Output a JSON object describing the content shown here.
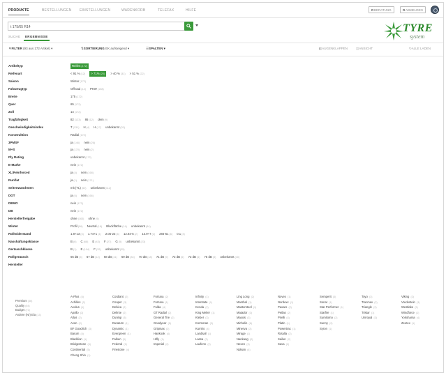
{
  "nav": {
    "items": [
      "PRODUKTE",
      "BESTELLUNGEN",
      "EINSTELLUNGEN",
      "WARENKORB",
      "TELEFAX",
      "HILFE"
    ],
    "buttons": [
      "BERATUNG",
      "ABMELDEN"
    ]
  },
  "search": {
    "value": "t 175/65 R14",
    "clear": "×"
  },
  "logo": {
    "word": "TYRE",
    "sub": "system"
  },
  "subtabs": [
    "SUCHE",
    "ERGEBNISSE"
  ],
  "filterbar": {
    "filter_label": "FILTER",
    "filter_text": "(93 aus 172 Artikel) ▾",
    "sort_label": "SORTIERUNG",
    "sort_text": "EK aufsteigend ▾",
    "columns_label": "SPALTEN ▾",
    "right": [
      "AUGENKLAPPEN",
      "ANSICHT",
      "ALLE LADEN"
    ]
  },
  "rows": [
    {
      "label": "Artikeltyp",
      "values": [
        {
          "t": "Reifen",
          "n": "172",
          "sel": true
        }
      ]
    },
    {
      "label": "Reifenart",
      "values": [
        {
          "t": "< 91 %",
          "n": "12"
        },
        {
          "t": "> 71%",
          "n": "20",
          "sel": true
        },
        {
          "t": "> 40 %",
          "n": "31"
        },
        {
          "t": "> 51 %",
          "n": "22"
        }
      ]
    },
    {
      "label": "Saison",
      "values": [
        {
          "t": "Winter",
          "n": "172"
        }
      ]
    },
    {
      "label": "Fahrzeugtyp",
      "values": [
        {
          "t": "Offroad",
          "n": "14"
        },
        {
          "t": "PKW",
          "n": "158"
        }
      ]
    },
    {
      "label": "Breite",
      "values": [
        {
          "t": "175",
          "n": "172"
        }
      ]
    },
    {
      "label": "Quer",
      "values": [
        {
          "t": "65",
          "n": "172"
        }
      ]
    },
    {
      "label": "Zoll",
      "values": [
        {
          "t": "14",
          "n": "172"
        }
      ]
    },
    {
      "label": "Tragfähigkeit",
      "values": [
        {
          "t": "82",
          "n": "123"
        },
        {
          "t": "86",
          "n": "12"
        },
        {
          "t": "dem",
          "n": "9"
        }
      ]
    },
    {
      "label": "Geschwindigkeitsindex",
      "values": [
        {
          "t": "T",
          "n": "131"
        },
        {
          "t": "H",
          "n": "4"
        },
        {
          "t": "H",
          "n": "17"
        },
        {
          "t": "unbekannt",
          "n": "20"
        }
      ]
    },
    {
      "label": "Konstruktion",
      "values": [
        {
          "t": "Radial",
          "n": "172"
        }
      ]
    },
    {
      "label": "3PMSF",
      "values": [
        {
          "t": "ja",
          "n": "146"
        },
        {
          "t": "nein",
          "n": "26"
        }
      ]
    },
    {
      "label": "M+S",
      "values": [
        {
          "t": "ja",
          "n": "170"
        },
        {
          "t": "nein",
          "n": "2"
        }
      ]
    },
    {
      "label": "Ply Rating",
      "values": [
        {
          "t": "unbekannt",
          "n": "172"
        }
      ]
    },
    {
      "label": "E-Marke",
      "values": [
        {
          "t": "nein",
          "n": "172"
        }
      ]
    },
    {
      "label": "XL/Reinforced",
      "values": [
        {
          "t": "ja",
          "n": "4"
        },
        {
          "t": "nein",
          "n": "168"
        }
      ]
    },
    {
      "label": "Runflat",
      "values": [
        {
          "t": "ja",
          "n": "1"
        },
        {
          "t": "nein",
          "n": "171"
        }
      ]
    },
    {
      "label": "Seitenwandrsten",
      "values": [
        {
          "t": "mit (TL)",
          "n": "60"
        },
        {
          "t": "unbekannt",
          "n": "112"
        }
      ]
    },
    {
      "label": "DOT",
      "values": [
        {
          "t": "ja",
          "n": "6"
        },
        {
          "t": "nein",
          "n": "166"
        }
      ]
    },
    {
      "label": "DEMO",
      "values": [
        {
          "t": "nein",
          "n": "172"
        }
      ]
    },
    {
      "label": "DB",
      "values": [
        {
          "t": "nein",
          "n": "172"
        }
      ]
    },
    {
      "label": "Herstellerfreigabe",
      "values": [
        {
          "t": "ohne",
          "n": "163"
        },
        {
          "t": "ohne",
          "n": "9"
        }
      ]
    },
    {
      "label": "Winter",
      "values": [
        {
          "t": "Profil",
          "n": "56"
        },
        {
          "t": "Neutral",
          "n": "18"
        },
        {
          "t": "Blockfläche",
          "n": "14"
        },
        {
          "t": "unbekannt",
          "n": "84"
        }
      ]
    },
    {
      "label": "Rollwiderstand",
      "values": [
        {
          "t": "1.8+13",
          "n": "3"
        },
        {
          "t": "1.74+1",
          "n": "4"
        },
        {
          "t": "2.06-23",
          "n": "6"
        },
        {
          "t": "12.84-5",
          "n": "2"
        },
        {
          "t": "13.9+7",
          "n": "2"
        },
        {
          "t": "284-51",
          "n": "6"
        },
        {
          "t": "0.1",
          "n": "3"
        }
      ]
    },
    {
      "label": "Nasshaftungsklasse",
      "values": [
        {
          "t": "B",
          "n": "6"
        },
        {
          "t": "C",
          "n": "68"
        },
        {
          "t": "E",
          "n": "43"
        },
        {
          "t": "F",
          "n": "27"
        },
        {
          "t": "G",
          "n": "5"
        },
        {
          "t": "unbekannt",
          "n": "23"
        }
      ]
    },
    {
      "label": "Geräuschklasse",
      "values": [
        {
          "t": "B",
          "n": "1"
        },
        {
          "t": "E",
          "n": "104"
        },
        {
          "t": "F",
          "n": "32"
        },
        {
          "t": "unbekannt",
          "n": "35"
        }
      ]
    },
    {
      "label": "Rollgeräusch",
      "values": [
        {
          "t": "66 dB",
          "n": "5"
        },
        {
          "t": "67 dB",
          "n": "12"
        },
        {
          "t": "68 dB",
          "n": "41"
        },
        {
          "t": "69 dB",
          "n": "34"
        },
        {
          "t": "70 dB",
          "n": "18"
        },
        {
          "t": "71 dB",
          "n": "9"
        },
        {
          "t": "72 dB",
          "n": "6"
        },
        {
          "t": "73 dB",
          "n": "4"
        },
        {
          "t": "75 dB",
          "n": "3"
        },
        {
          "t": "unbekannt",
          "n": "40"
        }
      ]
    },
    {
      "label": "Hersteller",
      "values": []
    }
  ],
  "hersteller_sub": [
    {
      "t": "Premium",
      "n": "36"
    },
    {
      "t": "Quality",
      "n": "64"
    },
    {
      "t": "Budget",
      "n": "72"
    },
    {
      "t": "Andere (Nr) Ela",
      "n": "13"
    }
  ],
  "manufacturers": [
    [
      {
        "t": "A-Plus",
        "n": "4"
      },
      {
        "t": "Achilles",
        "n": "2"
      },
      {
        "t": "Aeolus",
        "n": "1"
      },
      {
        "t": "Apollo",
        "n": "3"
      },
      {
        "t": "Atlas",
        "n": "2"
      },
      {
        "t": "Avon",
        "n": "2"
      },
      {
        "t": "BF Goodrich",
        "n": "3"
      },
      {
        "t": "Barum",
        "n": "4"
      },
      {
        "t": "Blacklion",
        "n": "1"
      },
      {
        "t": "Bridgestone",
        "n": "6"
      },
      {
        "t": "Continental",
        "n": "5"
      },
      {
        "t": "Cheng Shin",
        "n": "1"
      }
    ],
    [
      {
        "t": "Cordiant",
        "n": "2"
      },
      {
        "t": "Cooper",
        "n": "3"
      },
      {
        "t": "Debica",
        "n": "2"
      },
      {
        "t": "Delinte",
        "n": "2"
      },
      {
        "t": "Dunlop",
        "n": "5"
      },
      {
        "t": "Duraturn",
        "n": "1"
      },
      {
        "t": "Dynamic",
        "n": "1"
      },
      {
        "t": "Evergreen",
        "n": "1"
      },
      {
        "t": "Falken",
        "n": "3"
      },
      {
        "t": "Federal",
        "n": "2"
      },
      {
        "t": "Firestone",
        "n": "4"
      }
    ],
    [
      {
        "t": "Fortuna",
        "n": "2"
      },
      {
        "t": "Fortuna",
        "n": "1"
      },
      {
        "t": "Fulda",
        "n": "4"
      },
      {
        "t": "GT Radial",
        "n": "2"
      },
      {
        "t": "General Tire",
        "n": "2"
      },
      {
        "t": "Goodyear",
        "n": "5"
      },
      {
        "t": "Gripmax",
        "n": "2"
      },
      {
        "t": "Hankook",
        "n": "4"
      },
      {
        "t": "Hifly",
        "n": "1"
      },
      {
        "t": "Imperial",
        "n": "2"
      }
    ],
    [
      {
        "t": "Infinity",
        "n": "1"
      },
      {
        "t": "Interstate",
        "n": "1"
      },
      {
        "t": "Kenda",
        "n": "2"
      },
      {
        "t": "King Meiler",
        "n": "1"
      },
      {
        "t": "Kleber",
        "n": "3"
      },
      {
        "t": "Kormoran",
        "n": "3"
      },
      {
        "t": "Kumho",
        "n": "4"
      },
      {
        "t": "Landsail",
        "n": "1"
      },
      {
        "t": "Lassa",
        "n": "2"
      },
      {
        "t": "Laufenn",
        "n": "2"
      }
    ],
    [
      {
        "t": "Ling Long",
        "n": "2"
      },
      {
        "t": "Marshal",
        "n": "1"
      },
      {
        "t": "Mastersteel",
        "n": "1"
      },
      {
        "t": "Matador",
        "n": "3"
      },
      {
        "t": "Maxxis",
        "n": "3"
      },
      {
        "t": "Michelin",
        "n": "6"
      },
      {
        "t": "Minerva",
        "n": "2"
      },
      {
        "t": "Mirage",
        "n": "1"
      },
      {
        "t": "Nankang",
        "n": "2"
      },
      {
        "t": "Nexen",
        "n": "3"
      },
      {
        "t": "Nokian",
        "n": "4"
      }
    ],
    [
      {
        "t": "Novex",
        "n": "1"
      },
      {
        "t": "Nordexx",
        "n": "1"
      },
      {
        "t": "Paxaro",
        "n": "2"
      },
      {
        "t": "Petlas",
        "n": "2"
      },
      {
        "t": "Pirelli",
        "n": "4"
      },
      {
        "t": "Platin",
        "n": "1"
      },
      {
        "t": "Powertrac",
        "n": "1"
      },
      {
        "t": "Rotalla",
        "n": "2"
      },
      {
        "t": "Sailun",
        "n": "2"
      },
      {
        "t": "Sava",
        "n": "3"
      }
    ],
    [
      {
        "t": "Semperit",
        "n": "3"
      },
      {
        "t": "Sonar",
        "n": "1"
      },
      {
        "t": "Star Performer",
        "n": "1"
      },
      {
        "t": "Starfire",
        "n": "1"
      },
      {
        "t": "Sumitomo",
        "n": "2"
      },
      {
        "t": "Sunny",
        "n": "2"
      },
      {
        "t": "Syron",
        "n": "1"
      }
    ],
    [
      {
        "t": "Toyo",
        "n": "3"
      },
      {
        "t": "Tracmax",
        "n": "2"
      },
      {
        "t": "Triangle",
        "n": "2"
      },
      {
        "t": "Tristar",
        "n": "1"
      },
      {
        "t": "Uniroyal",
        "n": "3"
      }
    ],
    [
      {
        "t": "Viking",
        "n": "2"
      },
      {
        "t": "Vredestein",
        "n": "3"
      },
      {
        "t": "Westlake",
        "n": "2"
      },
      {
        "t": "Windforce",
        "n": "1"
      },
      {
        "t": "Yokohama",
        "n": "4"
      },
      {
        "t": "Zeetex",
        "n": "1"
      }
    ]
  ]
}
